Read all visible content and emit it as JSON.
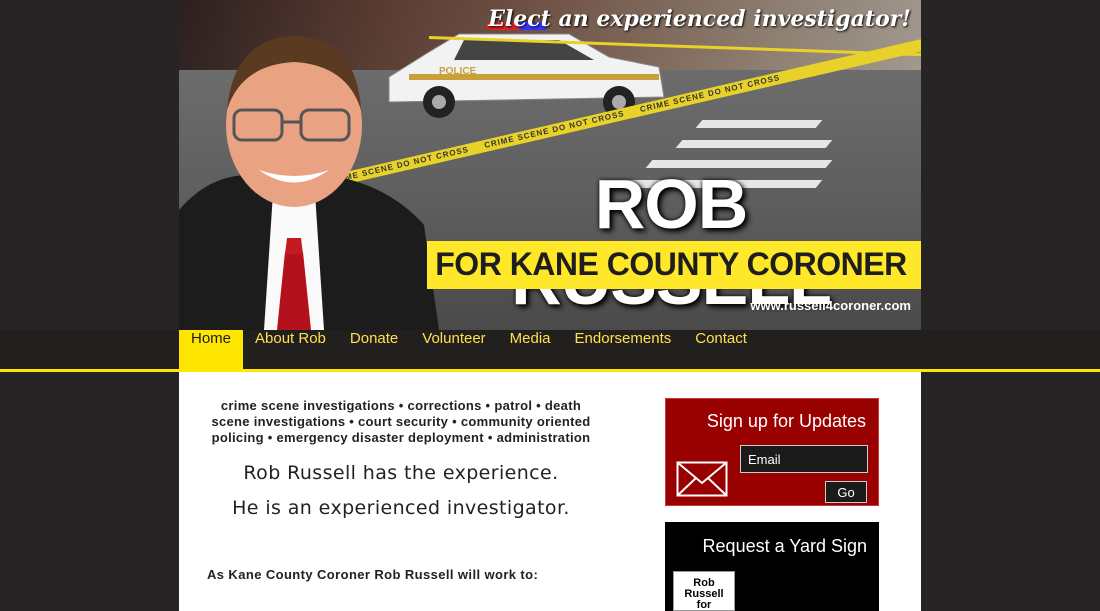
{
  "banner": {
    "slogan": "Elect an experienced investigator!",
    "candidate_name": "ROB RUSSELL",
    "office": "FOR KANE COUNTY CORONER",
    "url": "www.russell4coroner.com",
    "tape_text": "CRIME SCENE DO NOT CROSS",
    "car_label": "POLICE"
  },
  "nav": {
    "items": [
      {
        "label": "Home",
        "active": true
      },
      {
        "label": "About Rob"
      },
      {
        "label": "Donate"
      },
      {
        "label": "Volunteer"
      },
      {
        "label": "Media"
      },
      {
        "label": "Endorsements"
      },
      {
        "label": "Contact"
      }
    ]
  },
  "main": {
    "skills": "crime scene investigations • corrections • patrol • death scene investigations • court security • community oriented policing • emergency disaster deployment • administration",
    "experience_line_1": "Rob Russell has the experience.",
    "experience_line_2": "He is an experienced investigator.",
    "work_intro": "As Kane County Coroner Rob Russell will work to:"
  },
  "signup": {
    "title": "Sign up for Updates",
    "email_placeholder": "Email",
    "go_label": "Go",
    "icon": "envelope-icon"
  },
  "yard_sign": {
    "title": "Request a Yard Sign",
    "sign_line_1": "Rob Russell",
    "sign_line_2": "for Coroner"
  },
  "colors": {
    "accent_yellow": "#ffe600",
    "background": "#262424",
    "signup_red": "#990000"
  }
}
